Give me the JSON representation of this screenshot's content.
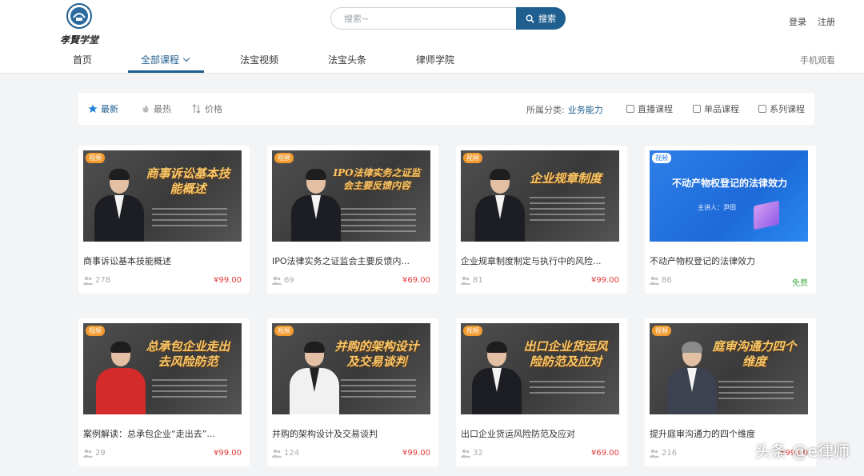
{
  "brand": {
    "logo_text": "孝賢学堂"
  },
  "search": {
    "placeholder": "搜索~",
    "button_label": "搜索"
  },
  "auth": {
    "login": "登录",
    "register": "注册"
  },
  "nav": {
    "items": [
      "首页",
      "全部课程",
      "法宝视频",
      "法宝头条",
      "律师学院"
    ],
    "active": "全部课程",
    "mobile": "手机观看"
  },
  "filters": {
    "sorts": [
      "最新",
      "最热",
      "价格"
    ],
    "active_sort": "最新",
    "category_label": "所属分类:",
    "category_value": "业务能力",
    "checkboxes": [
      "直播课程",
      "单品课程",
      "系列课程"
    ]
  },
  "courses": [
    {
      "badge": "视频",
      "cover_text": "商事诉讼基本技能概述",
      "title": "商事诉讼基本技能概述",
      "views": "278",
      "price": "¥99.00"
    },
    {
      "badge": "视频",
      "cover_text": "IPO法律实务之证监会主要反馈内容",
      "title": "IPO法律实务之证监会主要反馈内...",
      "views": "69",
      "price": "¥69.00"
    },
    {
      "badge": "视频",
      "cover_text": "企业规章制度",
      "title": "企业规章制度制定与执行中的风险...",
      "views": "81",
      "price": "¥99.00"
    },
    {
      "badge": "视频",
      "cover_text": "不动产物权登记的法律效力",
      "cover_sub": "主讲人：尹田",
      "title": "不动产物权登记的法律效力",
      "views": "86",
      "price": "免费"
    },
    {
      "badge": "视频",
      "cover_text": "总承包企业走出去风险防范",
      "title": "案例解读：总承包企业“走出去”...",
      "views": "29",
      "price": "¥99.00"
    },
    {
      "badge": "视频",
      "cover_text": "并购的架构设计及交易谈判",
      "title": "并购的架构设计及交易谈判",
      "views": "124",
      "price": "¥99.00"
    },
    {
      "badge": "视频",
      "cover_text": "出口企业货运风险防范及应对",
      "title": "出口企业货运风险防范及应对",
      "views": "32",
      "price": "¥69.00"
    },
    {
      "badge": "视频",
      "cover_text": "庭审沟通力四个维度",
      "title": "提升庭审沟通力的四个维度",
      "views": "216",
      "price": "¥99.00"
    }
  ],
  "colors": {
    "brand_blue": "#1f5f8f",
    "price_red": "#e2393a",
    "free_green": "#4caf50",
    "badge_orange": "#f29a2e"
  },
  "watermark": "头条 @e律师"
}
